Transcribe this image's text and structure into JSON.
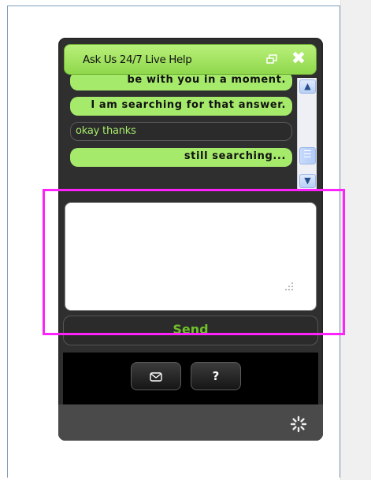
{
  "header": {
    "title": "Ask Us 24/7 Live Help",
    "popout_icon": "popout-window-icon",
    "close_icon": "close-x-icon",
    "accent": "#a6ea6b"
  },
  "messages": [
    {
      "sender": "staff",
      "text": "be with you in a moment."
    },
    {
      "sender": "staff",
      "text": "I am searching for that answer."
    },
    {
      "sender": "user",
      "text": "okay thanks"
    },
    {
      "sender": "staff",
      "text": "still searching..."
    }
  ],
  "input": {
    "value": "",
    "placeholder": ""
  },
  "send_label": "Send",
  "toolbar": {
    "email_icon": "envelope-icon",
    "help_label": "?"
  },
  "status": {
    "icon": "loading-spinner-icon"
  },
  "highlight_color": "#ff22ff"
}
